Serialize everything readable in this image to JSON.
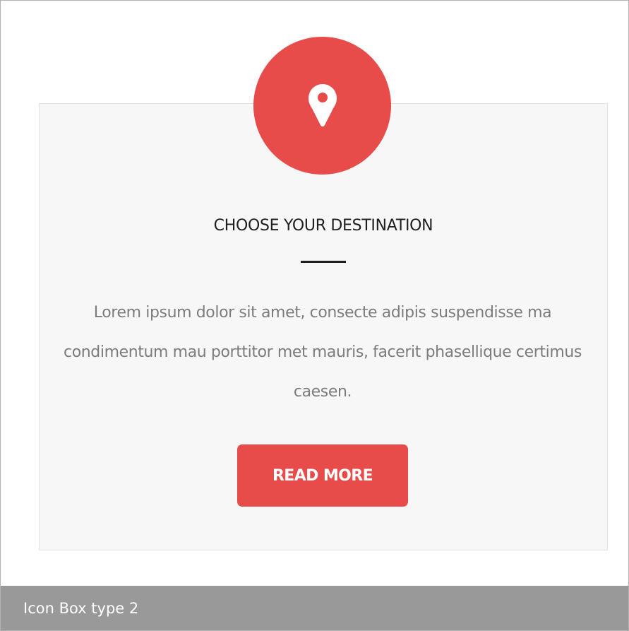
{
  "icon_box": {
    "icon": "map-pin-icon",
    "title": "CHOOSE YOUR DESTINATION",
    "description": "Lorem ipsum dolor sit amet, consecte adipis suspendisse ma condimentum mau porttitor met mauris, facerit phasellique certimus caesen.",
    "button_label": "READ MORE"
  },
  "caption": {
    "label": "Icon Box type 2"
  },
  "colors": {
    "accent": "#e84c4a",
    "box_background": "#f7f7f7",
    "title_text": "#1f1f1f",
    "body_text": "#7c7c7c",
    "caption_background": "#999999",
    "caption_text": "#ffffff"
  }
}
